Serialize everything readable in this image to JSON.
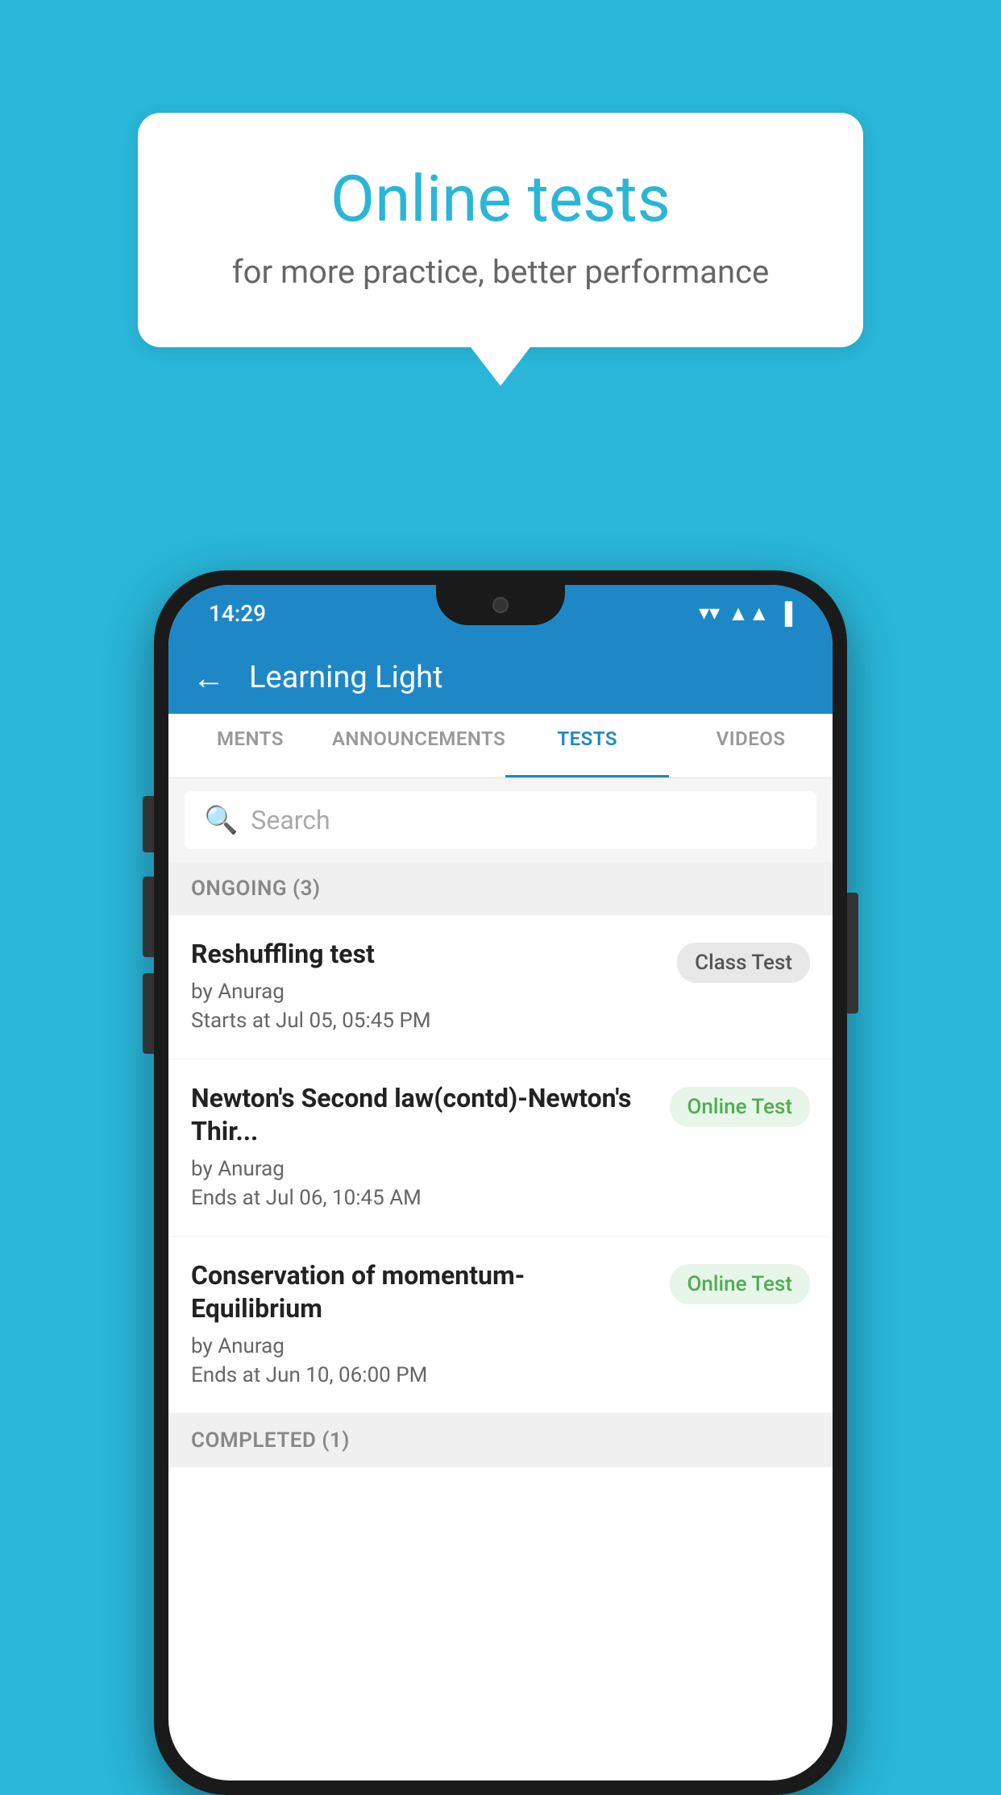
{
  "background_color": "#29b6d8",
  "speech_bubble": {
    "title": "Online tests",
    "subtitle": "for more practice, better performance"
  },
  "phone": {
    "status_bar": {
      "time": "14:29",
      "wifi_icon": "▼",
      "signal_icon": "▲",
      "battery_icon": "▮"
    },
    "header": {
      "back_label": "←",
      "title": "Learning Light"
    },
    "tabs": [
      {
        "label": "MENTS",
        "active": false
      },
      {
        "label": "ANNOUNCEMENTS",
        "active": false
      },
      {
        "label": "TESTS",
        "active": true
      },
      {
        "label": "VIDEOS",
        "active": false
      }
    ],
    "search": {
      "placeholder": "Search"
    },
    "ongoing_section": {
      "label": "ONGOING (3)"
    },
    "tests": [
      {
        "name": "Reshuffling test",
        "author": "by Anurag",
        "date": "Starts at  Jul 05, 05:45 PM",
        "badge": "Class Test",
        "badge_type": "class"
      },
      {
        "name": "Newton's Second law(contd)-Newton's Thir...",
        "author": "by Anurag",
        "date": "Ends at  Jul 06, 10:45 AM",
        "badge": "Online Test",
        "badge_type": "online"
      },
      {
        "name": "Conservation of momentum-Equilibrium",
        "author": "by Anurag",
        "date": "Ends at  Jun 10, 06:00 PM",
        "badge": "Online Test",
        "badge_type": "online"
      }
    ],
    "completed_section": {
      "label": "COMPLETED (1)"
    }
  }
}
